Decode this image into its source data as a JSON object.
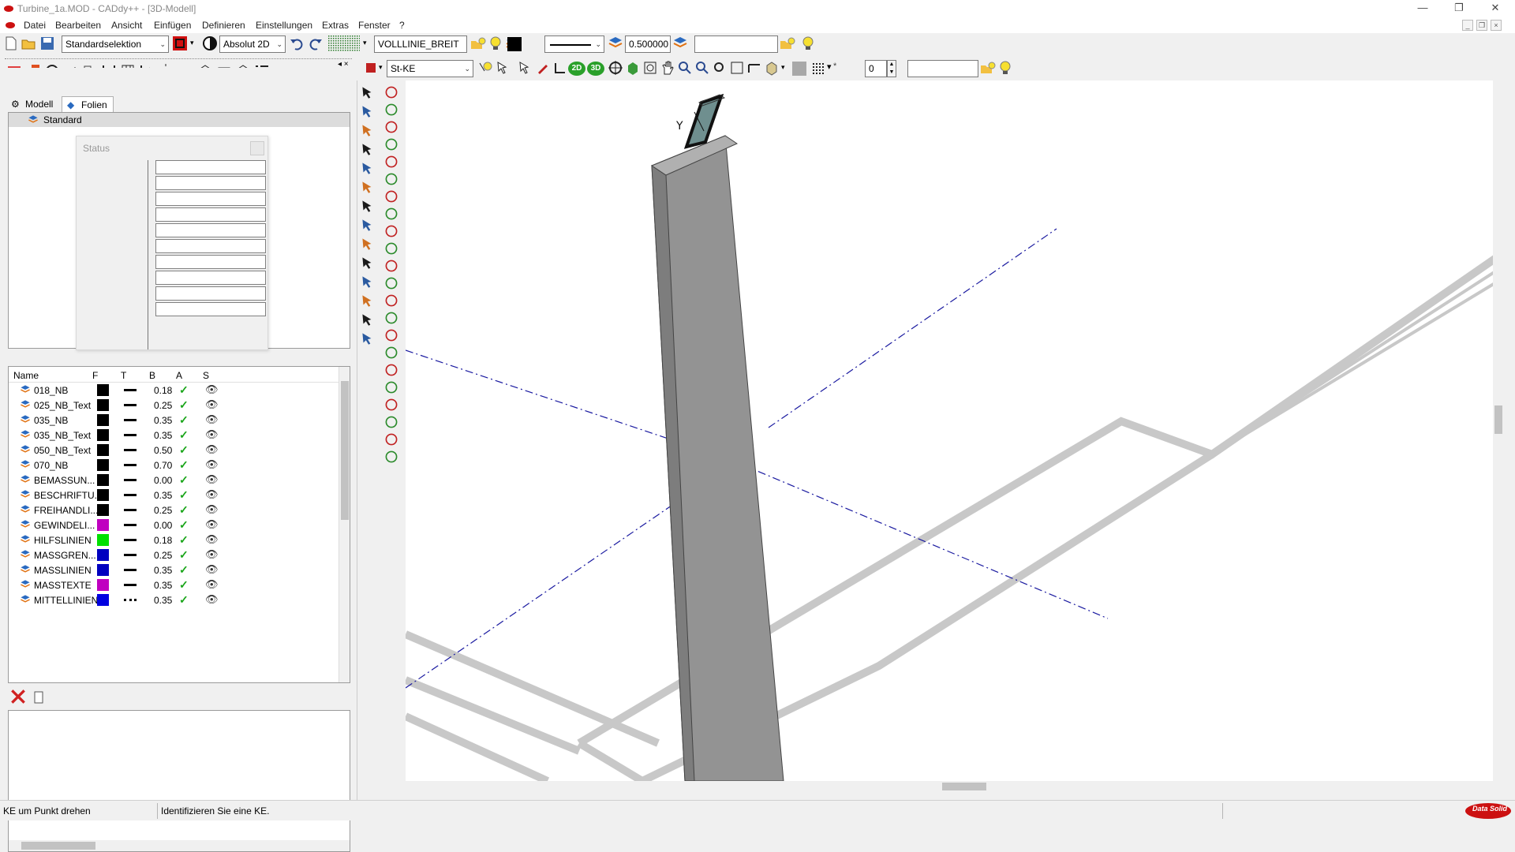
{
  "window": {
    "title": "Turbine_1a.MOD  - CADdy++ - [3D-Modell]",
    "controls": [
      "minimize-icon",
      "restore-icon",
      "close-icon"
    ]
  },
  "menu": {
    "items": [
      "Datei",
      "Bearbeiten",
      "Ansicht",
      "Einfügen",
      "Definieren",
      "Einstellungen",
      "Extras",
      "Fenster",
      "?"
    ]
  },
  "toolbar1": {
    "selection_mode": "Standardselektion",
    "coordinate_mode": "Absolut 2D",
    "line_type": "VOLLLINIE_BREIT",
    "line_width": "0.500000",
    "text_field": ""
  },
  "toolbar2": {
    "ke_type": "St-KE",
    "view_2d": "2D",
    "view_3d": "3D",
    "number_field": "0",
    "text_field": ""
  },
  "left_panel": {
    "tabs": [
      "Modell",
      "Folien"
    ],
    "active_tab": "Folien",
    "tree_root": "Standard",
    "status_dialog_title": "Status",
    "layer_columns": [
      "Name",
      "F",
      "T",
      "B",
      "A",
      "S"
    ],
    "layers": [
      {
        "name": "018_NB",
        "color": "#000000",
        "width": "0.18",
        "linetype": "solid"
      },
      {
        "name": "025_NB_Text",
        "color": "#000000",
        "width": "0.25",
        "linetype": "solid"
      },
      {
        "name": "035_NB",
        "color": "#000000",
        "width": "0.35",
        "linetype": "solid"
      },
      {
        "name": "035_NB_Text",
        "color": "#000000",
        "width": "0.35",
        "linetype": "solid"
      },
      {
        "name": "050_NB_Text",
        "color": "#000000",
        "width": "0.50",
        "linetype": "solid"
      },
      {
        "name": "070_NB",
        "color": "#000000",
        "width": "0.70",
        "linetype": "solid"
      },
      {
        "name": "BEMASSUN...",
        "color": "#000000",
        "width": "0.00",
        "linetype": "solid"
      },
      {
        "name": "BESCHRIFTU...",
        "color": "#000000",
        "width": "0.35",
        "linetype": "solid"
      },
      {
        "name": "FREIHANDLI...",
        "color": "#000000",
        "width": "0.25",
        "linetype": "solid"
      },
      {
        "name": "GEWINDELI...",
        "color": "#c000c0",
        "width": "0.00",
        "linetype": "solid"
      },
      {
        "name": "HILFSLINIEN",
        "color": "#00e000",
        "width": "0.18",
        "linetype": "solid"
      },
      {
        "name": "MASSGREN...",
        "color": "#0000c0",
        "width": "0.25",
        "linetype": "solid"
      },
      {
        "name": "MASSLINIEN",
        "color": "#0000c0",
        "width": "0.35",
        "linetype": "solid"
      },
      {
        "name": "MASSTEXTE",
        "color": "#c000c0",
        "width": "0.35",
        "linetype": "solid"
      },
      {
        "name": "MITTELLINIEN",
        "color": "#0000e0",
        "width": "0.35",
        "linetype": "dashdot"
      }
    ]
  },
  "statusbar": {
    "command": "KE um Punkt drehen",
    "prompt": "Identifizieren Sie eine KE."
  },
  "branding": {
    "logo_text": "Data Solid"
  },
  "colors": {
    "logo_red": "#cc1111",
    "canvas_bg": "#ffffff",
    "axis_blue": "#1a1aa0",
    "model_gray": "#909090"
  }
}
